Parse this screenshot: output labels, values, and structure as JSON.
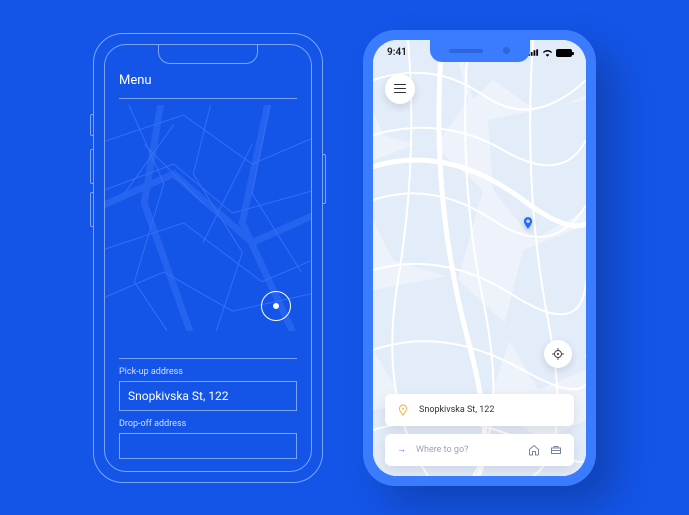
{
  "wireframe": {
    "menu_label": "Menu",
    "pickup_label": "Pick-up address",
    "pickup_value": "Snopkivska St, 122",
    "dropoff_label": "Drop-off address"
  },
  "hifi": {
    "status_time": "9:41",
    "pickup_value": "Snopkivska St, 122",
    "destination_placeholder": "Where to go?"
  },
  "colors": {
    "bg": "#1455e8",
    "accent": "#2e6dff"
  }
}
